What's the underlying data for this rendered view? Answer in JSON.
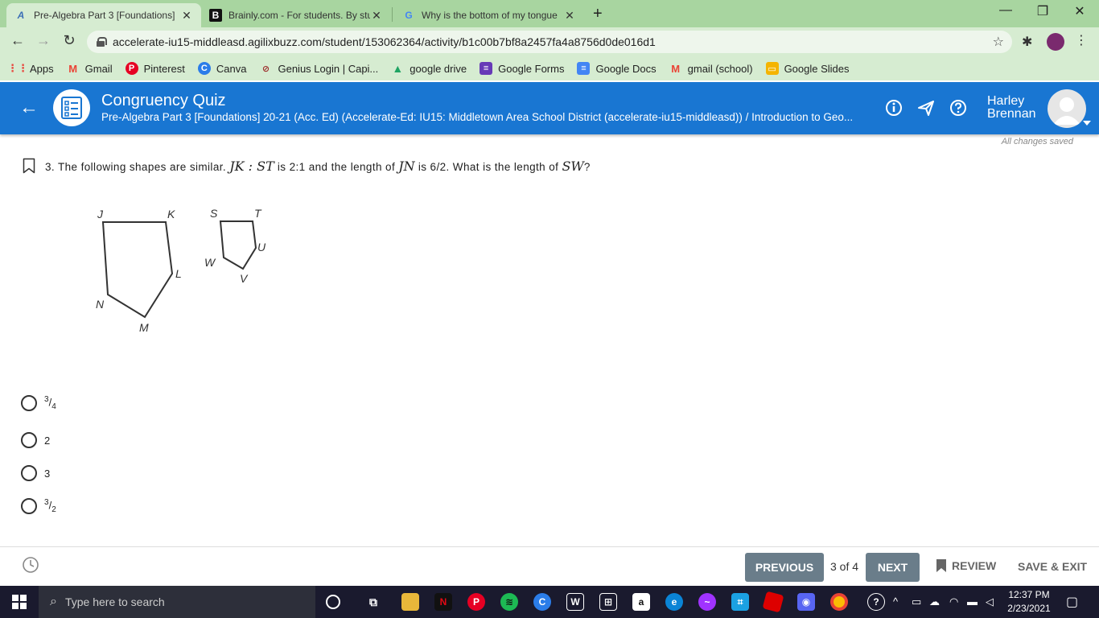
{
  "browser": {
    "tabs": [
      {
        "title": "Pre-Algebra Part 3 [Foundations]",
        "favicon": "A",
        "active": true
      },
      {
        "title": "Brainly.com - For students. By stu",
        "favicon": "B",
        "active": false
      },
      {
        "title": "Why is the bottom of my tongue",
        "favicon": "G",
        "active": false
      }
    ],
    "url": "accelerate-iu15-middleasd.agilixbuzz.com/student/153062364/activity/b1c00b7bf8a2457fa4a8756d0de016d1"
  },
  "bookmarks": [
    {
      "label": "Apps",
      "icon": "apps-grid-icon",
      "color": "#e8453c"
    },
    {
      "label": "Gmail",
      "icon": "gmail-icon",
      "color": "#ea4335"
    },
    {
      "label": "Pinterest",
      "icon": "pinterest-icon",
      "color": "#e60023"
    },
    {
      "label": "Canva",
      "icon": "canva-icon",
      "color": "#2b7de9"
    },
    {
      "label": "Genius Login | Capi...",
      "icon": "genius-icon",
      "color": "#9c2a2a"
    },
    {
      "label": "google drive",
      "icon": "google-drive-icon",
      "color": "#1fa463"
    },
    {
      "label": "Google Forms",
      "icon": "google-forms-icon",
      "color": "#673ab7"
    },
    {
      "label": "Google Docs",
      "icon": "google-docs-icon",
      "color": "#4285f4"
    },
    {
      "label": "gmail (school)",
      "icon": "gmail-icon",
      "color": "#ea4335"
    },
    {
      "label": "Google Slides",
      "icon": "google-slides-icon",
      "color": "#f4b400"
    }
  ],
  "header": {
    "title": "Congruency Quiz",
    "breadcrumb": "Pre-Algebra Part 3 [Foundations] 20-21 (Acc. Ed) (Accelerate-Ed: IU15: Middletown Area School District (accelerate-iu15-middleasd)) / Introduction to Geo...",
    "user_first": "Harley",
    "user_last": "Brennan",
    "accent_color": "#1976d2"
  },
  "save_status": "All changes saved",
  "question": {
    "number": "3.",
    "text_1": "The following shapes are similar.",
    "seg_1": "JK : ST",
    "text_2": "is 2:1 and the length of",
    "seg_2": "JN",
    "text_3": "is 6/2. What is the length of",
    "seg_3": "SW",
    "text_4": "?"
  },
  "figure": {
    "large_labels": [
      "J",
      "K",
      "L",
      "M",
      "N"
    ],
    "small_labels": [
      "S",
      "T",
      "U",
      "V",
      "W"
    ]
  },
  "options": [
    {
      "num": "3",
      "den": "4",
      "type": "fraction"
    },
    {
      "text": "2",
      "type": "plain"
    },
    {
      "text": "3",
      "type": "plain"
    },
    {
      "num": "3",
      "den": "2",
      "type": "fraction"
    }
  ],
  "footer": {
    "previous": "PREVIOUS",
    "pager": "3 of 4",
    "next": "NEXT",
    "review": "REVIEW",
    "save_exit": "SAVE & EXIT"
  },
  "taskbar": {
    "search_placeholder": "Type here to search",
    "time": "12:37 PM",
    "date": "2/23/2021"
  }
}
